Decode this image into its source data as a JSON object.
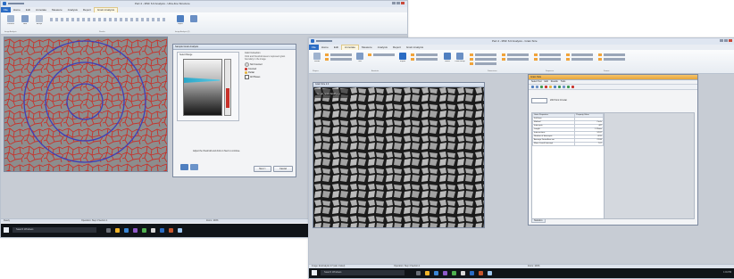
{
  "left_window": {
    "title": "Part 4 - MSF 6.0 Analysis - Ultra-fine Structure",
    "tabs": [
      "File",
      "Home",
      "Edit",
      "Annotate",
      "Measure",
      "Analysis",
      "Report",
      "Grain Analysis"
    ],
    "active_tab": "Grain Analysis",
    "ribbon_groups": [
      "Image Analysis",
      "Results",
      "Image Analysis (2)"
    ],
    "ribbon_buttons": [
      "Previous",
      "Next",
      "Accept",
      "Reject"
    ],
    "dialog": {
      "title": "Sample Grain Analysis",
      "panel_label": "Select Range",
      "options_label": "Color Correction",
      "options_text": "Click and threshold area to represent grain boundary in the image",
      "legend": [
        "Not Counted",
        "Counted",
        "Partial"
      ],
      "checkbox": "All Phases",
      "instruction": "Adjust the threshold and click on Next to continue.",
      "next_label": "Next >",
      "cancel_label": "Cancel"
    },
    "status": "Ready",
    "status_mid": "Operation: Step 4 Section 1",
    "status_right": "Zoom: 100%"
  },
  "right_window": {
    "title": "Part 4 - MSF 6.0 Analysis - Grain Size",
    "tabs": [
      "File",
      "Home",
      "Edit",
      "Annotate",
      "Measure",
      "Analysis",
      "Report",
      "Grain Analysis"
    ],
    "active_tab": "Annotate",
    "ribbon_buttons": [
      "Pointer",
      "Line",
      "Rectangle",
      "Text",
      "Arrow",
      "Ellipse",
      "Polygon",
      "Angle",
      "Delete",
      "Label Group"
    ],
    "ribbon_groups": [
      "Shapes",
      "Annotate",
      "Dimensions",
      "Sequence",
      "Format"
    ],
    "image_title": "Grain Size 2.0",
    "image_caption": "Grain Size Analysis",
    "results": {
      "title": "Grain Size",
      "menu": [
        "Select Text",
        "Edit",
        "Results",
        "Tools"
      ],
      "dropdown": "200 Point Circular",
      "table_headers": [
        "Grain Properties",
        "Property Value"
      ],
      "rows": [
        {
          "label": "Full lines",
          "value": ""
        },
        {
          "label": "Method",
          "value": "Circle"
        },
        {
          "label": "Intercepts",
          "value": "447"
        },
        {
          "label": "Length",
          "value": "1.25mm"
        },
        {
          "label": "Intersections",
          "value": "52.87"
        },
        {
          "label": "Number of Intercepts",
          "value": "4211"
        },
        {
          "label": "Average Grain Area um",
          "value": "21.86"
        },
        {
          "label": "Mean Lineal Intercept",
          "value": "7.07"
        }
      ],
      "footer_tab": "Statistics"
    },
    "status": "Image: ExtAnalysis 47 (ask 1 label)",
    "status_mid": "Operation: Step 4 Section 1",
    "status_right": "Zoom: 100%"
  },
  "taskbar": {
    "search_placeholder": "Search Windows",
    "clock": "1:01 PM"
  },
  "colors": {
    "grain_boundary": "#c8312a",
    "grain_fill": "#8a8a8a",
    "circle": "#3d3fb8",
    "accent": "#2b6cc4",
    "dark_micro_bg": "#1b1b1b"
  }
}
